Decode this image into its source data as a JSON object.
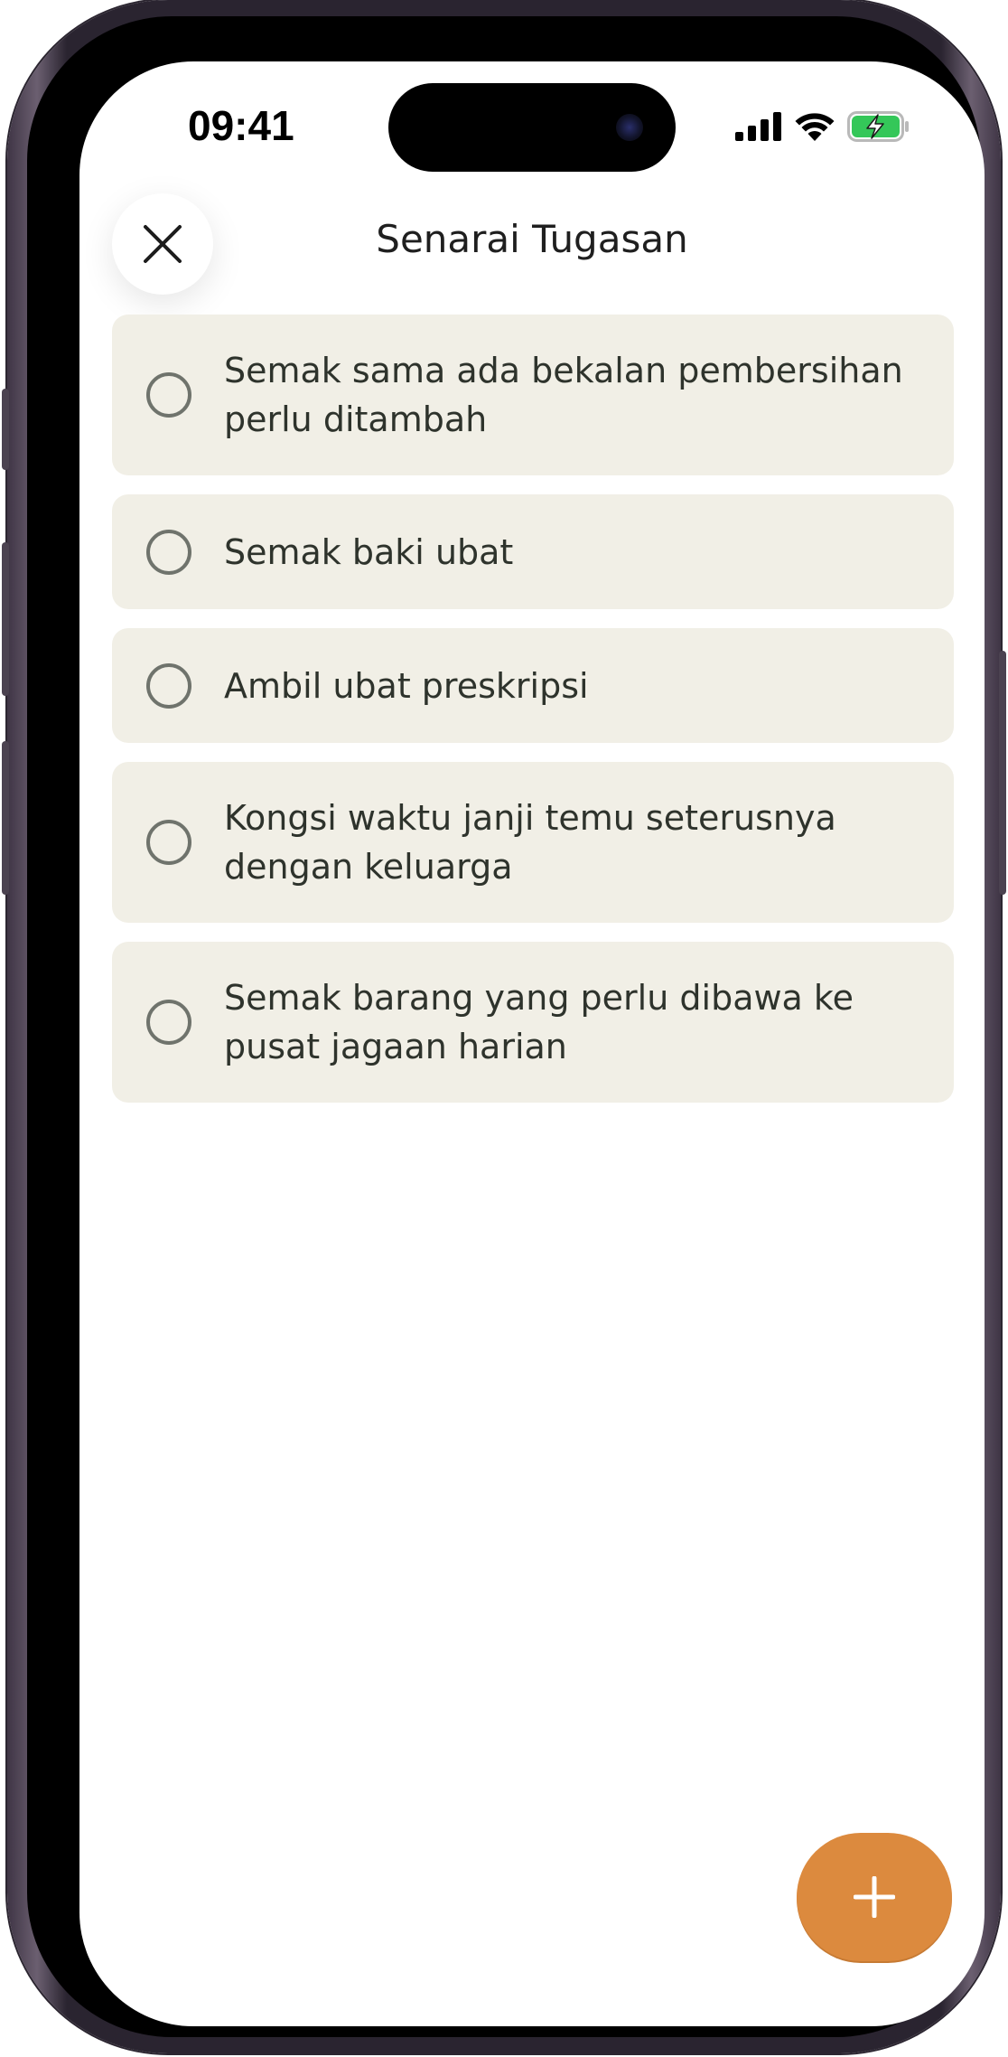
{
  "status_bar": {
    "time": "09:41"
  },
  "header": {
    "title": "Senarai Tugasan",
    "close_icon": "close-icon"
  },
  "tasks": [
    {
      "text": "Semak sama ada bekalan pembersihan perlu ditambah",
      "done": false
    },
    {
      "text": "Semak baki ubat",
      "done": false
    },
    {
      "text": "Ambil ubat preskripsi",
      "done": false
    },
    {
      "text": "Kongsi waktu janji temu seterusnya dengan keluarga",
      "done": false
    },
    {
      "text": "Semak barang yang perlu dibawa ke pusat jagaan harian",
      "done": false
    }
  ],
  "fab": {
    "icon": "plus-icon"
  },
  "colors": {
    "task_background": "#f1efe6",
    "accent": "#dc8a3e",
    "battery": "#34c759"
  }
}
